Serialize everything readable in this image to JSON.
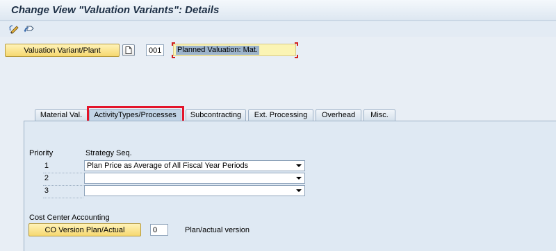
{
  "window": {
    "title": "Change View \"Valuation Variants\": Details"
  },
  "toolbar": {
    "icons": [
      "edit-pencil-icon",
      "undo-icon"
    ]
  },
  "header": {
    "variant_button": "Valuation Variant/Plant",
    "variant_value": "001",
    "variant_description": "Planned Valuation: Mat."
  },
  "tabs": [
    {
      "label": "Material Val."
    },
    {
      "label": "ActivityTypes/Processes",
      "active": true
    },
    {
      "label": "Subcontracting"
    },
    {
      "label": "Ext. Processing"
    },
    {
      "label": "Overhead"
    },
    {
      "label": "Misc."
    }
  ],
  "strategy": {
    "priority_label": "Priority",
    "strategy_label": "Strategy Seq.",
    "rows": [
      {
        "priority": "1",
        "value": "Plan Price as Average of All Fiscal Year Periods"
      },
      {
        "priority": "2",
        "value": ""
      },
      {
        "priority": "3",
        "value": ""
      }
    ]
  },
  "cost_center": {
    "section_label": "Cost Center Accounting",
    "version_button": "CO Version Plan/Actual",
    "version_value": "0",
    "version_text": "Plan/actual version"
  }
}
